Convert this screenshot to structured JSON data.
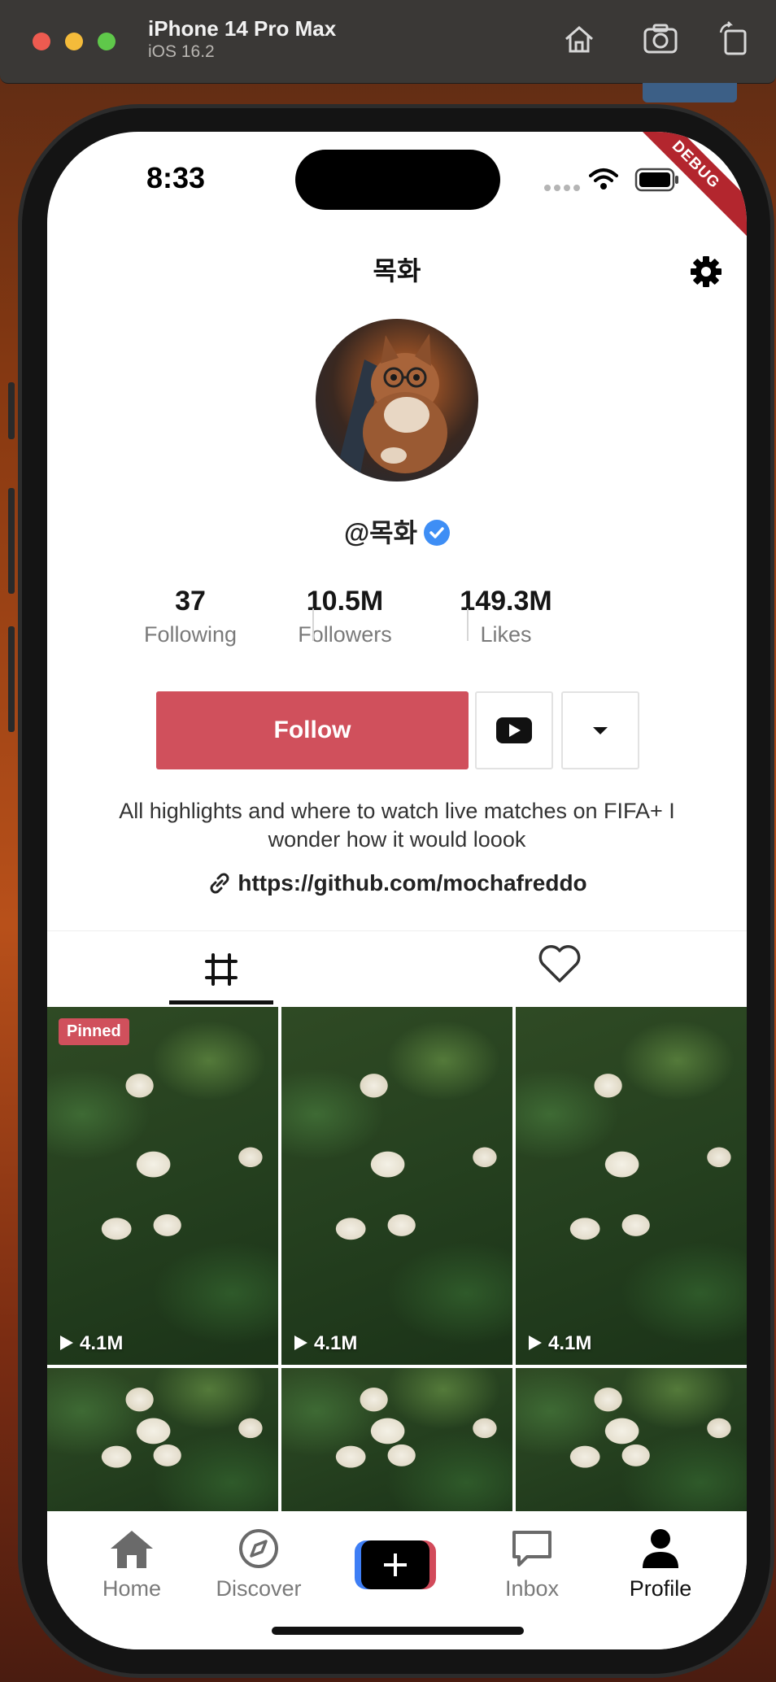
{
  "simulator": {
    "device_name": "iPhone 14 Pro Max",
    "os_version": "iOS 16.2"
  },
  "status_bar": {
    "time": "8:33",
    "debug_banner": "DEBUG"
  },
  "profile": {
    "title": "목화",
    "handle": "@목화",
    "stats": [
      {
        "value": "37",
        "label": "Following"
      },
      {
        "value": "10.5M",
        "label": "Followers"
      },
      {
        "value": "149.3M",
        "label": "Likes"
      }
    ],
    "follow_label": "Follow",
    "bio": "All highlights and where to watch live matches on FIFA+ I wonder how it would loook",
    "link": "https://github.com/mochafreddo"
  },
  "grid": {
    "pinned_label": "Pinned",
    "videos": [
      {
        "views": "4.1M"
      },
      {
        "views": "4.1M"
      },
      {
        "views": "4.1M"
      }
    ]
  },
  "nav": {
    "home": "Home",
    "discover": "Discover",
    "inbox": "Inbox",
    "profile": "Profile"
  },
  "colors": {
    "accent": "#d0505c",
    "verified": "#3e8ef5"
  }
}
